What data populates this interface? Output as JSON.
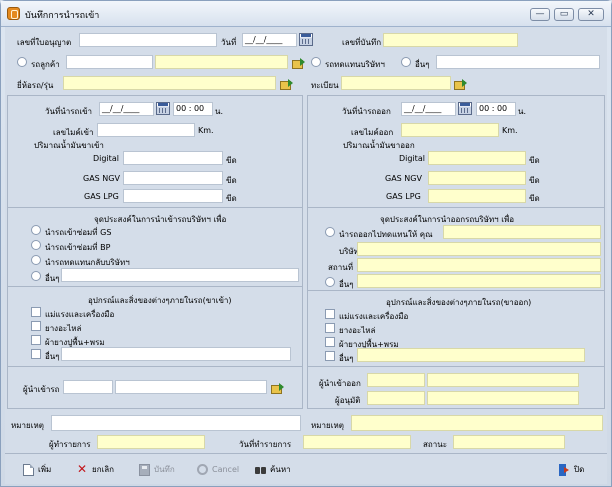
{
  "window": {
    "title": "บันทึกการนำรถเข้า",
    "minimize": "—",
    "restore": "▭",
    "close": "✕"
  },
  "top": {
    "permit_no_label": "เลขที่ใบอนุญาต",
    "date_label": "วันที่",
    "date_value": "__/__/____",
    "record_no_label": "เลขที่บันทึก",
    "car_customer_label": "รถลูกค้า",
    "replacement_car_label": "รถทดแทนบริษัทฯ",
    "other_label": "อื่นๆ",
    "brand_model_label": "ยี่ห้อรถ/รุ่น",
    "registration_label": "ทะเบียน"
  },
  "checkin": {
    "date_label": "วันที่นำรถเข้า",
    "date_value": "__/__/____",
    "hour": "00",
    "minute": "00",
    "time_unit": "น.",
    "mileage_label": "เลขไมค์เข้า",
    "mileage_unit": "Km.",
    "fuel_heading": "ปริมาณน้ำมันขาเข้า",
    "fuel": [
      {
        "label": "Digital",
        "unit": "ขีด"
      },
      {
        "label": "GAS NGV",
        "unit": "ขีด"
      },
      {
        "label": "GAS LPG",
        "unit": "ขีด"
      }
    ],
    "purpose_title": "จุดประสงค์ในการนำเข้ารถบริษัทฯ เพื่อ",
    "purpose_options": [
      "นำรถเข้าซ่อมที่ GS",
      "นำรถเข้าซ่อมที่ BP",
      "นำรถทดแทนกลับบริษัทฯ",
      "อื่นๆ"
    ],
    "equipment_title": "อุปกรณ์และสิ่งของต่างๆภายในรถ(ขาเข้า)",
    "equipment_options": [
      "แม่แรงและเครื่องมือ",
      "ยางอะไหล่",
      "ผ้ายางปูพื้น+พรม",
      "อื่นๆ"
    ],
    "driver_label": "ผู้นำเข้ารถ",
    "note_label": "หมายเหตุ"
  },
  "checkout": {
    "date_label": "วันที่นำรถออก",
    "date_value": "__/__/____",
    "hour": "00",
    "minute": "00",
    "time_unit": "น.",
    "mileage_label": "เลขไมค์ออก",
    "mileage_unit": "Km.",
    "fuel_heading": "ปริมาณน้ำมันขาออก",
    "fuel": [
      {
        "label": "Digital",
        "unit": "ขีด"
      },
      {
        "label": "GAS NGV",
        "unit": "ขีด"
      },
      {
        "label": "GAS LPG",
        "unit": "ขีด"
      }
    ],
    "purpose_title": "จุดประสงค์ในการนำออกรถบริษัทฯ เพื่อ",
    "purpose_option": "นำรถออกไปทดแทนให้ คุณ",
    "company_label": "บริษัท",
    "place_label": "สถานที่",
    "other_label": "อื่นๆ",
    "equipment_title": "อุปกรณ์และสิ่งของต่างๆภายในรถ(ขาออก)",
    "equipment_options": [
      "แม่แรงและเครื่องมือ",
      "ยางอะไหล่",
      "ผ้ายางปูพื้น+พรม",
      "อื่นๆ"
    ],
    "driver_label": "ผู้นำเข้าออก",
    "approver_label": "ผู้อนุมัติ",
    "note_label": "หมายเหตุ"
  },
  "footer_info": {
    "operator_label": "ผู้ทำรายการ",
    "operation_date_label": "วันที่ทำรายการ",
    "status_label": "สถานะ"
  },
  "toolbar": {
    "add": "เพิ่ม",
    "cancel_edit": "ยกเลิก",
    "save": "บันทึก",
    "cancel": "Cancel",
    "search": "ค้นหา",
    "close": "ปิด"
  },
  "colors": {
    "background": "#d4dde9",
    "required_field": "#ffffcc",
    "border": "#aab6c7"
  }
}
